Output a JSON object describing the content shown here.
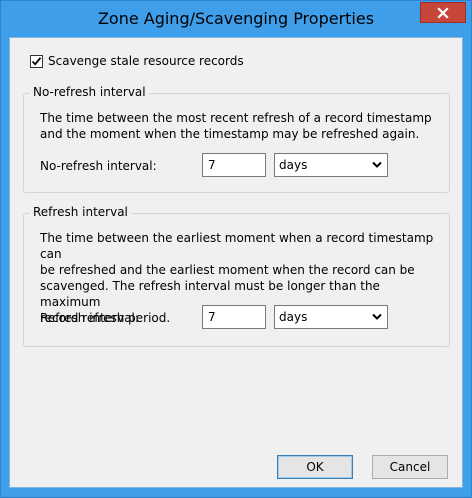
{
  "window": {
    "title": "Zone Aging/Scavenging Properties",
    "close_icon": "close-x-icon"
  },
  "scavenge": {
    "label": "Scavenge stale resource records",
    "checked": true
  },
  "no_refresh": {
    "legend": "No-refresh interval",
    "desc_lines": [
      "The time between the most recent refresh of a record timestamp",
      "and the moment when the timestamp may be refreshed again."
    ],
    "field_label": "No-refresh interval:",
    "value": "7",
    "unit": "days"
  },
  "refresh": {
    "legend": "Refresh interval",
    "desc_lines": [
      "The time between the earliest moment when a record timestamp can",
      "be refreshed and the earliest moment when the record can be",
      "scavenged. The refresh interval must be longer than the maximum",
      "record refresh period."
    ],
    "field_label": "Refresh interval:",
    "value": "7",
    "unit": "days"
  },
  "buttons": {
    "ok": "OK",
    "cancel": "Cancel"
  },
  "colors": {
    "title_bar": "#3f9ee9",
    "close_button": "#c7463a",
    "dialog_bg": "#f0f0f0"
  }
}
